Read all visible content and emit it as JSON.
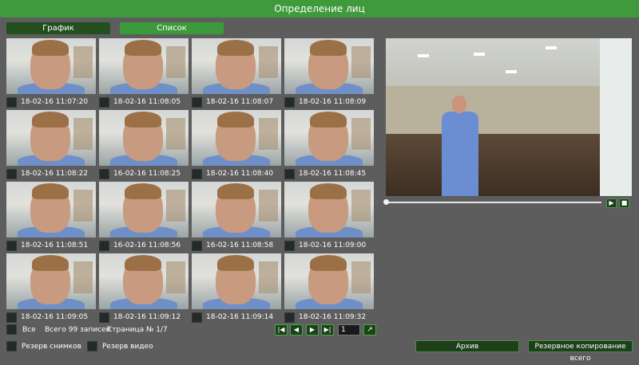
{
  "title": "Определение лиц",
  "tabs": {
    "graph": "График",
    "list": "Список"
  },
  "thumbnails": [
    {
      "time": "18-02-16 11:07:20",
      "selected": true
    },
    {
      "time": "18-02-16 11:08:05"
    },
    {
      "time": "18-02-16 11:08:07"
    },
    {
      "time": "18-02-16 11:08:09"
    },
    {
      "time": "18-02-16 11:08:22"
    },
    {
      "time": "16-02-16 11:08:25"
    },
    {
      "time": "18-02-16 11:08:40"
    },
    {
      "time": "18-02-16 11:08:45"
    },
    {
      "time": "18-02-16 11:08:51"
    },
    {
      "time": "16-02-16 11:08:56"
    },
    {
      "time": "16-02-16 11:08:58"
    },
    {
      "time": "18-02-16 11:09:00"
    },
    {
      "time": "18-02-16 11:09:05"
    },
    {
      "time": "18-02-16 11:09:12"
    },
    {
      "time": "18-02-16 11:09:14"
    },
    {
      "time": "18-02-16 11:09:32"
    }
  ],
  "footer": {
    "all_label": "Все",
    "total_label": "Всего 99 записей",
    "page_label": "Страница № 1/7",
    "snapshot_backup_label": "Резерв снимков",
    "video_backup_label": "Резерв видео",
    "page_value": "1",
    "archive_button": "Архив",
    "backup_all_button": "Резервное копирование всего"
  },
  "player": {
    "play_icon": "play-icon",
    "stop_icon": "stop-icon",
    "progress": 0
  }
}
